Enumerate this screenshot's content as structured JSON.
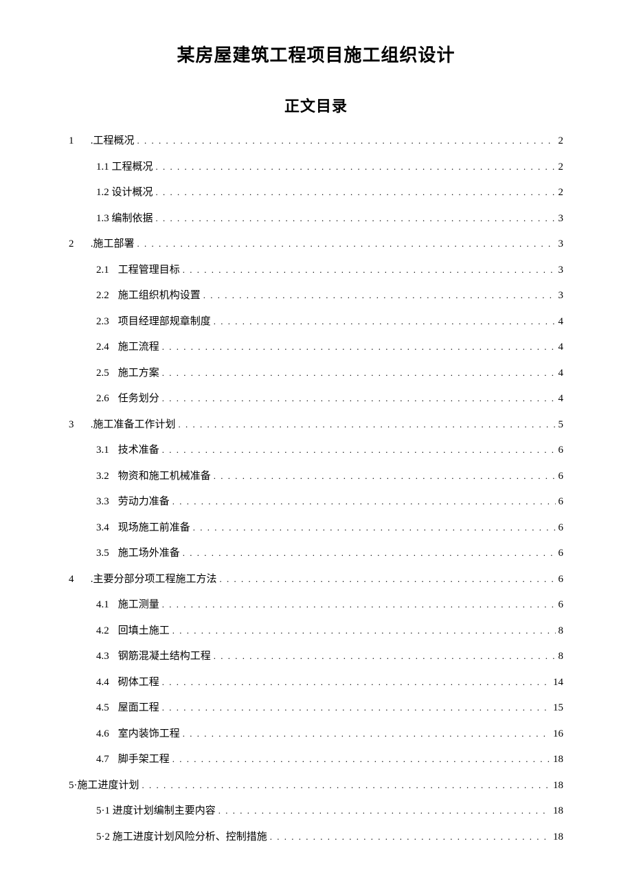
{
  "title": "某房屋建筑工程项目施工组织设计",
  "toc_title": "正文目录",
  "entries": [
    {
      "level": 1,
      "num": "1",
      "text": ".工程概况",
      "page": "2"
    },
    {
      "level": 2,
      "num": "",
      "text": "1.1 工程概况",
      "page": "2"
    },
    {
      "level": 2,
      "num": "",
      "text": "1.2 设计概况",
      "page": "2"
    },
    {
      "level": 2,
      "num": "",
      "text": "1.3 编制依据",
      "page": "3"
    },
    {
      "level": 1,
      "num": "2",
      "text": ".施工部署",
      "page": "3"
    },
    {
      "level": 2,
      "num": "2.1",
      "text": "工程管理目标",
      "page": "3"
    },
    {
      "level": 2,
      "num": "2.2",
      "text": "施工组织机构设置",
      "page": "3"
    },
    {
      "level": 2,
      "num": "2.3",
      "text": "项目经理部规章制度",
      "page": "4"
    },
    {
      "level": 2,
      "num": "2.4",
      "text": "施工流程",
      "page": "4"
    },
    {
      "level": 2,
      "num": "2.5",
      "text": "施工方案",
      "page": "4"
    },
    {
      "level": 2,
      "num": "2.6",
      "text": "任务划分",
      "page": "4"
    },
    {
      "level": 1,
      "num": "3",
      "text": ".施工准备工作计划",
      "page": "5"
    },
    {
      "level": 2,
      "num": "3.1",
      "text": "技术准备",
      "page": "6"
    },
    {
      "level": 2,
      "num": "3.2",
      "text": "物资和施工机械准备",
      "page": "6"
    },
    {
      "level": 2,
      "num": "3.3",
      "text": "劳动力准备",
      "page": "6"
    },
    {
      "level": 2,
      "num": "3.4",
      "text": "现场施工前准备",
      "page": "6"
    },
    {
      "level": 2,
      "num": "3.5",
      "text": "施工场外准备",
      "page": "6"
    },
    {
      "level": 1,
      "num": "4",
      "text": ".主要分部分项工程施工方法",
      "page": "6"
    },
    {
      "level": 2,
      "num": "4.1",
      "text": "施工测量",
      "page": "6"
    },
    {
      "level": 2,
      "num": "4.2",
      "text": "回填土施工",
      "page": "8"
    },
    {
      "level": 2,
      "num": "4.3",
      "text": "钢筋混凝土结构工程",
      "page": "8"
    },
    {
      "level": 2,
      "num": "4.4",
      "text": "砌体工程",
      "page": "14"
    },
    {
      "level": 2,
      "num": "4.5",
      "text": "屋面工程",
      "page": "15"
    },
    {
      "level": 2,
      "num": "4.6",
      "text": "室内装饰工程",
      "page": "16"
    },
    {
      "level": 2,
      "num": "4.7",
      "text": "脚手架工程",
      "page": "18"
    },
    {
      "level": 1,
      "num": "",
      "text": "5·施工进度计划",
      "page": "18"
    },
    {
      "level": 2,
      "num": "",
      "text": "5·1 进度计划编制主要内容",
      "page": "18"
    },
    {
      "level": 2,
      "num": "",
      "text": "5·2 施工进度计划风险分析、控制措施",
      "page": "18"
    }
  ]
}
